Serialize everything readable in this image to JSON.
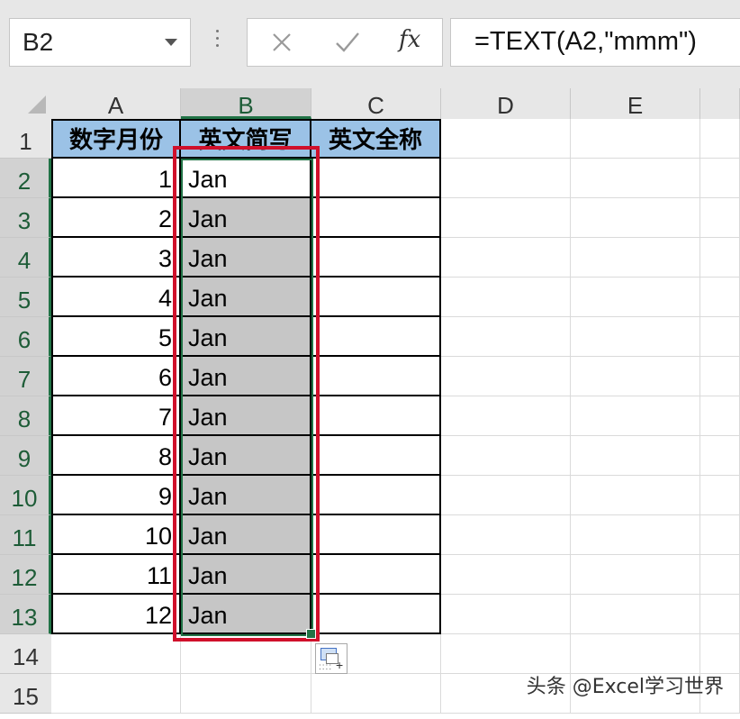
{
  "formula_bar": {
    "name_box": "B2",
    "formula": "=TEXT(A2,\"mmm\")",
    "fx_label": "fx",
    "icons": [
      "cancel-x-icon",
      "enter-check-icon",
      "insert-function-icon",
      "dropdown-arrow-icon"
    ]
  },
  "sheet": {
    "columns": [
      "A",
      "B",
      "C",
      "D",
      "E"
    ],
    "rows": [
      "1",
      "2",
      "3",
      "4",
      "5",
      "6",
      "7",
      "8",
      "9",
      "10",
      "11",
      "12",
      "13",
      "14",
      "15"
    ],
    "selected_column": "B",
    "active_cell": "B2",
    "selection": "B2:B13",
    "header_fill_color": "#9bc2e6",
    "selection_color": "#217346",
    "highlight_box_color": "#d0102b",
    "headers": [
      "数字月份",
      "英文简写",
      "英文全称"
    ],
    "data": [
      {
        "a": "1",
        "b": "Jan"
      },
      {
        "a": "2",
        "b": "Jan"
      },
      {
        "a": "3",
        "b": "Jan"
      },
      {
        "a": "4",
        "b": "Jan"
      },
      {
        "a": "5",
        "b": "Jan"
      },
      {
        "a": "6",
        "b": "Jan"
      },
      {
        "a": "7",
        "b": "Jan"
      },
      {
        "a": "8",
        "b": "Jan"
      },
      {
        "a": "9",
        "b": "Jan"
      },
      {
        "a": "10",
        "b": "Jan"
      },
      {
        "a": "11",
        "b": "Jan"
      },
      {
        "a": "12",
        "b": "Jan"
      }
    ]
  },
  "watermark": "头条 @Excel学习世界"
}
